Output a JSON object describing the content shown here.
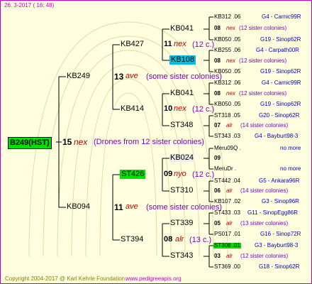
{
  "header": {
    "date": "26. 3-2017 ( 16: 48)"
  },
  "footer": {
    "copyright": "Copyright 2004-2017 @ Karl Kehrle Foundation.",
    "url": "www.pedigreeapis.org"
  },
  "root": {
    "id": "B249(HST)",
    "num": "15",
    "race": "nex",
    "desc": "(Drones from 12 sister colonies)"
  },
  "nodes": {
    "kb249": {
      "id": "KB249",
      "num": "13",
      "race": "ave",
      "desc": "(some sister colonies)"
    },
    "kb427": {
      "id": "KB427",
      "num": "11",
      "race": "nex",
      "desc": "(12 c.)"
    },
    "kb041a": {
      "id": "KB041"
    },
    "kb108": {
      "id": "KB108"
    },
    "kb414": {
      "id": "KB414",
      "num": "10",
      "race": "nex",
      "desc": "(12 c.)"
    },
    "kb041b": {
      "id": "KB041"
    },
    "st348": {
      "id": "ST348"
    },
    "kb094": {
      "id": "KB094",
      "num": "11",
      "race": "ave",
      "desc": "(some sister colonies)"
    },
    "st426": {
      "id": "ST426",
      "num": "09",
      "race": "nyo",
      "desc": "(12 c.)"
    },
    "kb024": {
      "id": "KB024"
    },
    "st310": {
      "id": "ST310"
    },
    "st394": {
      "id": "ST394",
      "num": "08",
      "race": "alr",
      "desc": "(13 c.)"
    },
    "st339": {
      "id": "ST339"
    },
    "st343": {
      "id": "ST343"
    }
  },
  "rows": [
    {
      "a": "KB312 .06",
      "b": "G4 - Carnic99R"
    },
    {
      "num": "08",
      "race": "nex",
      "desc": "(12 sister colonies)"
    },
    {
      "a": "KB050 .05",
      "b": "G19 - Sinop62R"
    },
    {
      "a": "KB255 .06",
      "b": "G4 - Carpath00R"
    },
    {
      "num": "08",
      "race": "nex",
      "desc": "(12 sister colonies)"
    },
    {
      "a": "KB050 .05",
      "b": "G19 - Sinop62R"
    },
    {
      "a": "KB312 .06",
      "b": "G4 - Carnic99R"
    },
    {
      "num": "08",
      "race": "nex",
      "desc": "(12 sister colonies)"
    },
    {
      "a": "KB050 .05",
      "b": "G19 - Sinop62R"
    },
    {
      "a": "ST318 .05",
      "b": "G20 - Sinop62R"
    },
    {
      "num": "07",
      "race": "alr",
      "desc": "(14 sister colonies)"
    },
    {
      "a": "ST343 .03",
      "b": "G4 - Bayburt98-3"
    },
    {
      "a": "Meru09Q .",
      "b": "no more"
    },
    {
      "num": "09",
      "race": "",
      "desc": ""
    },
    {
      "a": "MeruDr .",
      "b": "no more"
    },
    {
      "a": "ST442 .04",
      "b": "G5 - Ankara96R"
    },
    {
      "num": "06",
      "race": "alr",
      "desc": "(14 sister colonies)"
    },
    {
      "a": "KB107 .02",
      "b": "G3 - Sinop96R"
    },
    {
      "a": "ST433 .03",
      "b": "G11 - SinopEgg86R"
    },
    {
      "num": "05",
      "race": "alr",
      "desc": "(13 sister colonies)"
    },
    {
      "a": "PS017 .01",
      "b": "G16 - Sinop72R"
    },
    {
      "a": "ST308 .01",
      "b": "G3 - Bayburt98-3"
    },
    {
      "num": "03",
      "race": "alr",
      "desc": "(12 sister colonies)"
    },
    {
      "a": "ST369 .00",
      "b": "G18 - Sinop62R"
    }
  ]
}
